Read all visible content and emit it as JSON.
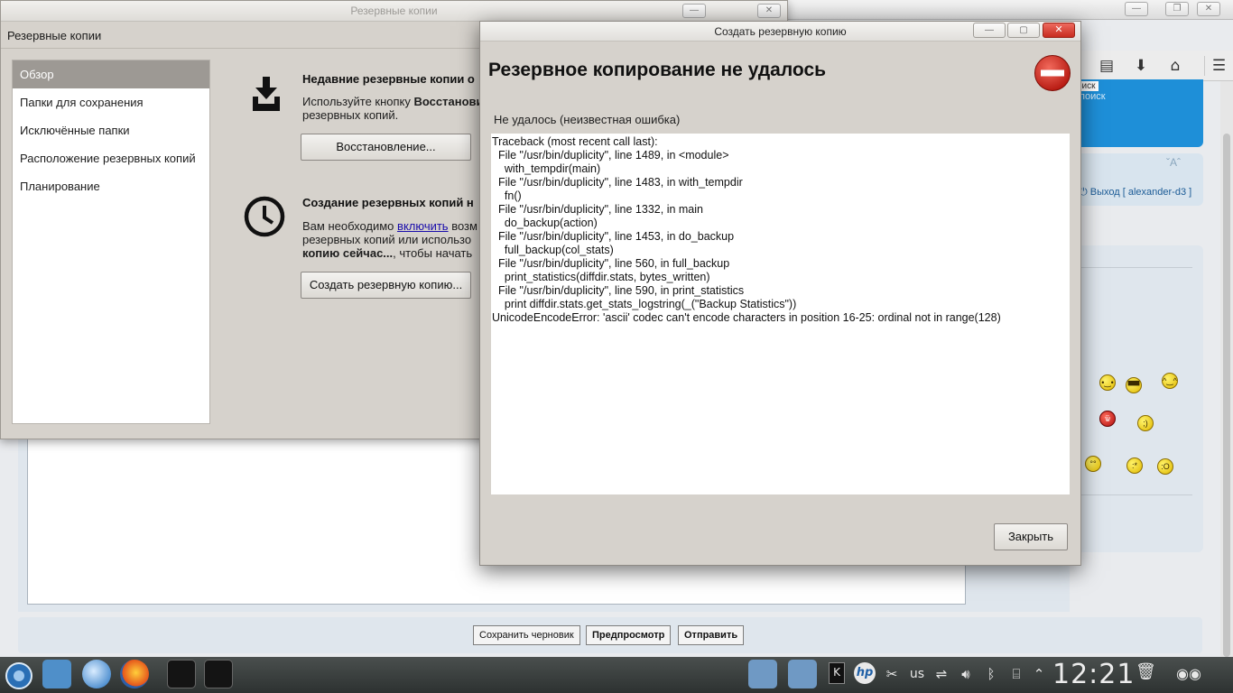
{
  "backups_window": {
    "title": "Резервные копии",
    "header": "Резервные копии",
    "sidebar": [
      {
        "label": "Обзор",
        "selected": true
      },
      {
        "label": "Папки для сохранения",
        "selected": false
      },
      {
        "label": "Исключённые папки",
        "selected": false
      },
      {
        "label": "Расположение резервных копий",
        "selected": false
      },
      {
        "label": "Планирование",
        "selected": false
      }
    ],
    "restore_section": {
      "icon": "download-tray-icon",
      "title": "Недавние резервные копии о",
      "line1_pre": "Используйте кнопку ",
      "line1_bold": "Восстанови",
      "line2": "резервных копий.",
      "button": "Восстановление..."
    },
    "create_section": {
      "icon": "clock-icon",
      "title": "Создание резервных копий н",
      "line1_pre": "Вам необходимо ",
      "line1_link": "включить",
      "line1_post": " возм",
      "line2": "резервных копий или использо",
      "line3_bold": "копию сейчас...",
      "line3_post": ", чтобы начать",
      "button": "Создать резервную копию..."
    }
  },
  "dialog": {
    "title": "Создать резервную копию",
    "heading": "Резервное копирование не удалось",
    "icon": "error-stop-icon",
    "message": "Не удалось (неизвестная ошибка)",
    "traceback": [
      "Traceback (most recent call last):",
      "  File \"/usr/bin/duplicity\", line 1489, in <module>",
      "    with_tempdir(main)",
      "  File \"/usr/bin/duplicity\", line 1483, in with_tempdir",
      "    fn()",
      "  File \"/usr/bin/duplicity\", line 1332, in main",
      "    do_backup(action)",
      "  File \"/usr/bin/duplicity\", line 1453, in do_backup",
      "    full_backup(col_stats)",
      "  File \"/usr/bin/duplicity\", line 560, in full_backup",
      "    print_statistics(diffdir.stats, bytes_written)",
      "  File \"/usr/bin/duplicity\", line 590, in print_statistics",
      "    print diffdir.stats.get_stats_logstring(_(\"Backup Statistics\"))",
      "UnicodeEncodeError: 'ascii' codec can't encode characters in position 16-25: ordinal not in range(128)"
    ],
    "close_button": "Закрыть"
  },
  "browser": {
    "toolbar_icons": [
      "reading-list-icon",
      "download-icon",
      "home-icon",
      "menu-icon"
    ],
    "search_tag": "оиск",
    "search_text": "поиск",
    "font_controls": "ˇAˆ",
    "logout": "Выход [ alexander-d3 ]",
    "buttons": {
      "save_draft": "Сохранить черновик",
      "preview": "Предпросмотр",
      "submit": "Отправить"
    }
  },
  "taskbar": {
    "keyboard_layout": "us",
    "clock": "12:21"
  },
  "colors": {
    "sidebar_selected": "#9d9994",
    "dialog_bg": "#d6d2cc",
    "error_red": "#d42a22",
    "forum_blue": "#1e8fd8",
    "taskbar": "#3a3f3e"
  }
}
